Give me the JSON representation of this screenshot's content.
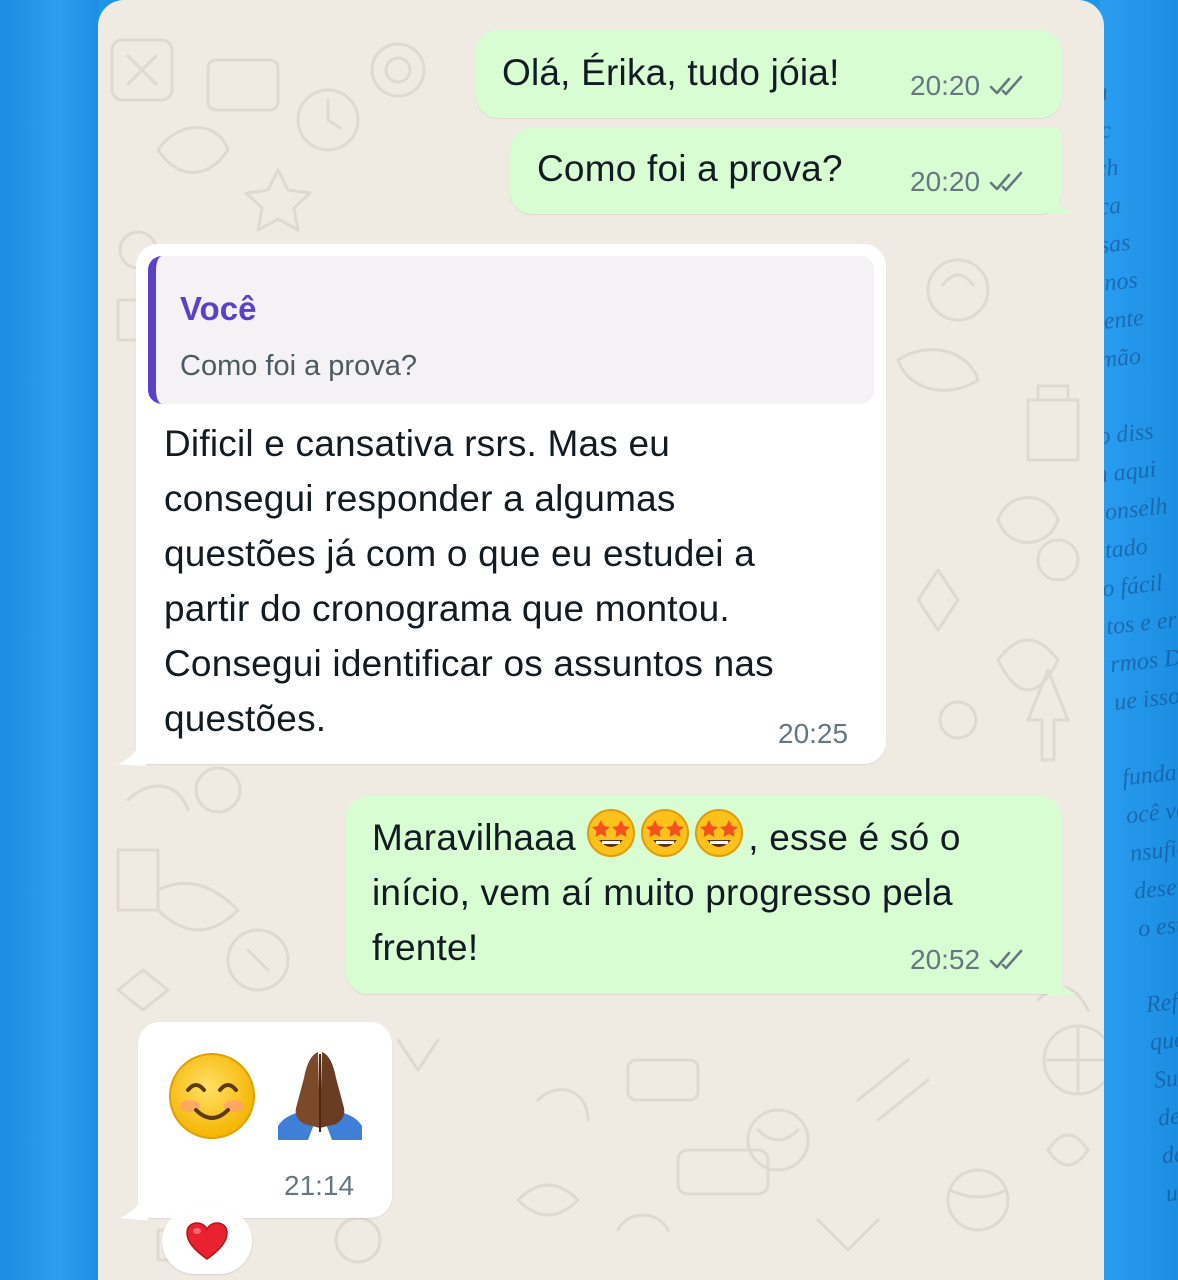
{
  "background": {
    "page_text_lines": [
      "rnada",
      "lhas c",
      "esfech",
      "o a ca",
      "nossas",
      "lar nos",
      "amente",
      "ramão",
      "",
      "do diss",
      "m aqui",
      "conselh",
      "ltado",
      "o fácil",
      "tos e er",
      "rmos D",
      "ue isso",
      "",
      "fundam",
      "ocê vai",
      "nsuficiên",
      "desenca",
      "o estado",
      "",
      "Refletin",
      "questio",
      "Suas es",
      "de De",
      "das a",
      "uni"
    ]
  },
  "colors": {
    "outgoing_bubble": "#d9fdd3",
    "incoming_bubble": "#ffffff",
    "chat_background": "#efeae2",
    "quote_accent": "#5b41c9",
    "read_ticks": "#667781"
  },
  "messages": [
    {
      "id": "m1",
      "direction": "outgoing",
      "text": "Olá, Érika, tudo jóia!",
      "time": "20:20",
      "status_icon": "double-check-icon"
    },
    {
      "id": "m2",
      "direction": "outgoing",
      "text": "Como foi a prova?",
      "time": "20:20",
      "status_icon": "double-check-icon"
    },
    {
      "id": "m3",
      "direction": "incoming",
      "quote": {
        "author": "Você",
        "text": "Como foi a prova?"
      },
      "lines": [
        "Dificil e cansativa rsrs. Mas eu",
        "consegui responder a algumas",
        "questões já com o que eu estudei a",
        "partir do cronograma que montou.",
        "Consegui identificar os assuntos nas",
        "questões."
      ],
      "time": "20:25"
    },
    {
      "id": "m4",
      "direction": "outgoing",
      "lines": [
        "Maravilhaaa",
        ", esse é só o",
        "início, vem aí muito progresso pela",
        "frente!"
      ],
      "emojis": [
        "star-struck-emoji",
        "star-struck-emoji",
        "star-struck-emoji"
      ],
      "time": "20:52",
      "status_icon": "double-check-icon"
    },
    {
      "id": "m5",
      "direction": "incoming",
      "emojis": [
        "smiling-face-emoji",
        "folded-hands-emoji"
      ],
      "time": "21:14",
      "reaction": "red-heart-emoji"
    }
  ]
}
